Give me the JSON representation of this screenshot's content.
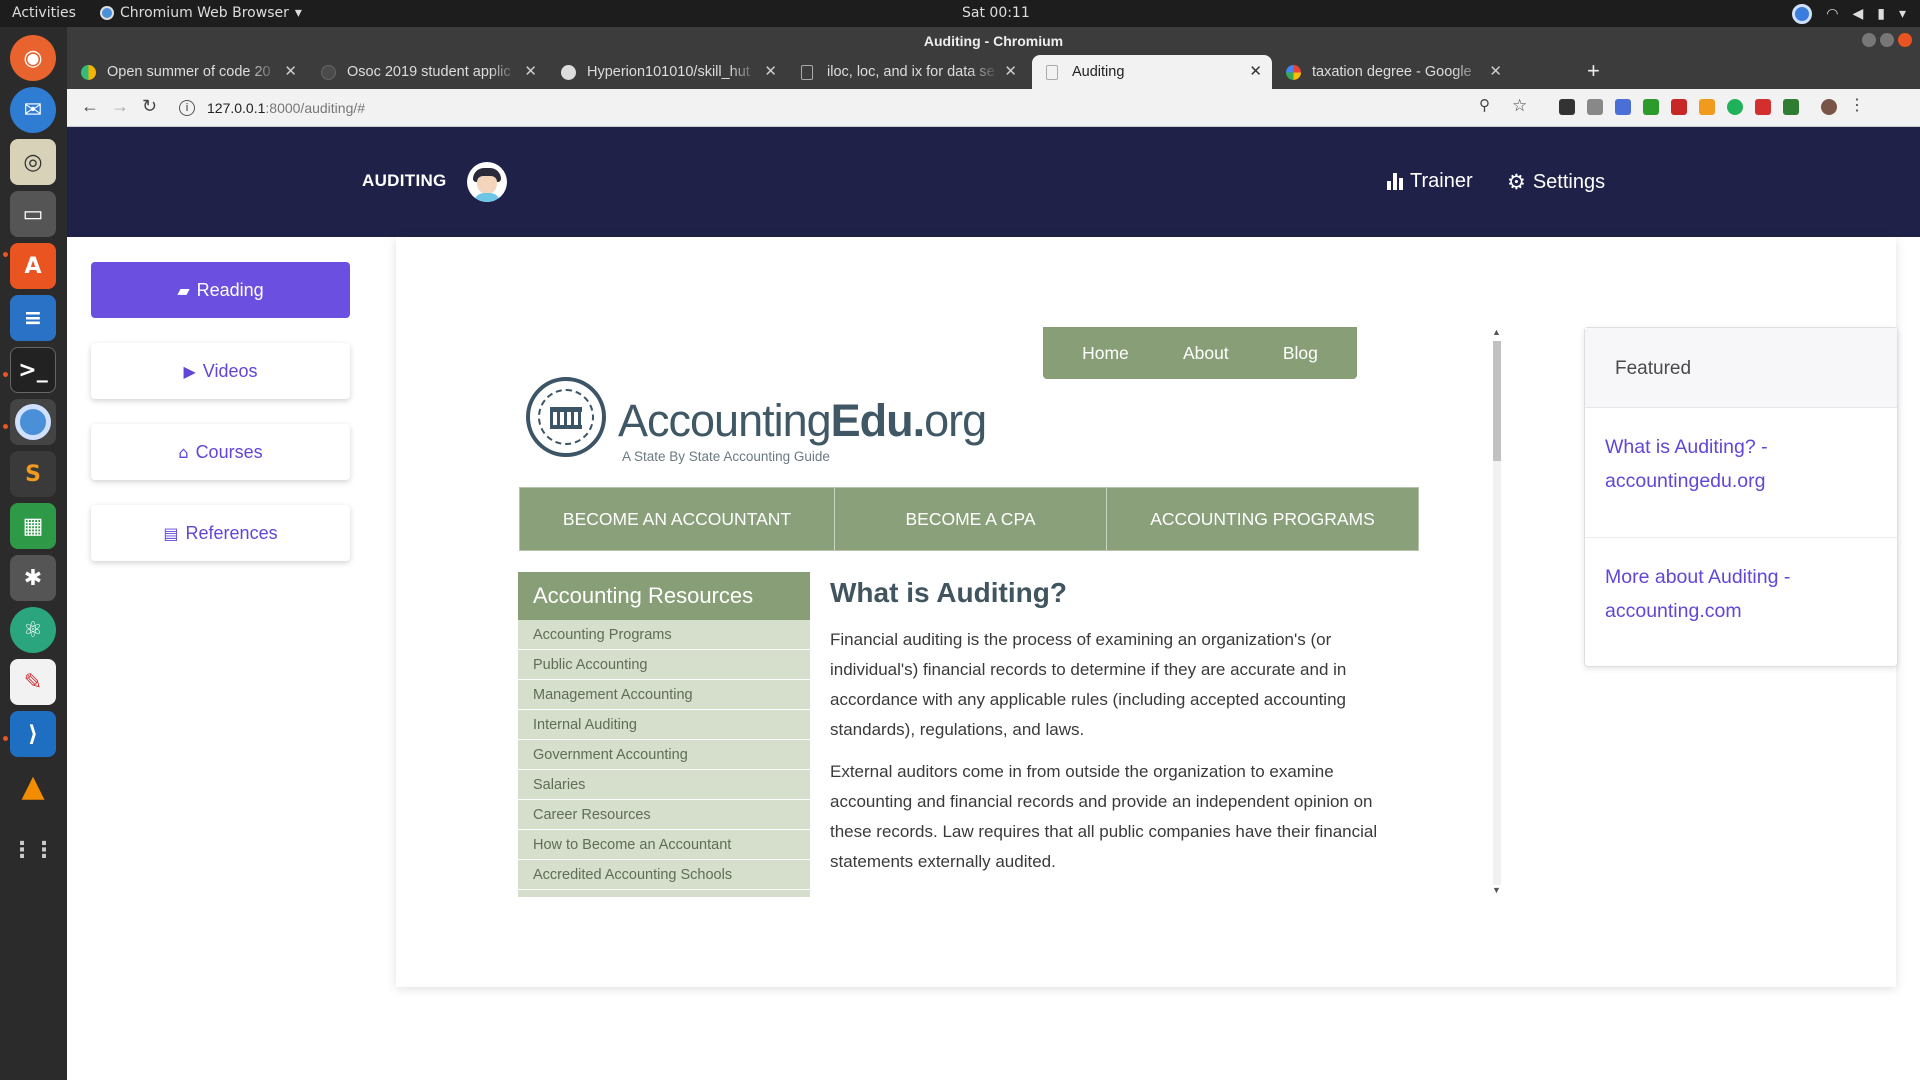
{
  "system": {
    "activities": "Activities",
    "app_menu": "Chromium Web Browser",
    "clock": "Sat 00:11"
  },
  "browser": {
    "window_title": "Auditing - Chromium",
    "tabs": [
      {
        "title": "Open summer of code 20"
      },
      {
        "title": "Osoc 2019 student applic"
      },
      {
        "title": "Hyperion101010/skill_hut"
      },
      {
        "title": "iloc, loc, and ix for data se"
      },
      {
        "title": "Auditing"
      },
      {
        "title": "taxation degree - Google"
      }
    ],
    "url_host": "127.0.0.1",
    "url_path": ":8000/auditing/#"
  },
  "app": {
    "brand": "AUDITING",
    "nav": {
      "trainer": "Trainer",
      "settings": "Settings"
    },
    "sidebar": [
      {
        "label": "Reading",
        "icon": "book-icon"
      },
      {
        "label": "Videos",
        "icon": "play-icon"
      },
      {
        "label": "Courses",
        "icon": "institution-icon"
      },
      {
        "label": "References",
        "icon": "file-icon"
      }
    ],
    "accent": "#6a4fe0",
    "navbar_bg": "#1f2148"
  },
  "embed": {
    "site_nav": [
      "Home",
      "About",
      "Blog"
    ],
    "logo_light": "Accounting",
    "logo_bold": "Edu.",
    "logo_tail": "org",
    "tagline": "A State By State Accounting Guide",
    "categories": [
      "BECOME AN ACCOUNTANT",
      "BECOME A CPA",
      "ACCOUNTING PROGRAMS"
    ],
    "resources_title": "Accounting Resources",
    "resources": [
      "Accounting Programs",
      "Public Accounting",
      "Management Accounting",
      "Internal Auditing",
      "Government Accounting",
      "Salaries",
      "Career Resources",
      "How to Become an Accountant",
      "Accredited Accounting Schools"
    ],
    "article_title": "What is Auditing?",
    "article_p1": "Financial auditing is the process of examining an organization's (or individual's) financial records to determine if they are accurate and in accordance with any applicable rules (including accepted accounting standards), regulations, and laws.",
    "article_p2": "External auditors come in from outside the organization to examine accounting and financial records and provide an independent opinion on these records. Law requires that all public companies have their financial statements externally audited."
  },
  "featured": {
    "title": "Featured",
    "links": [
      "What is Auditing? - accountingedu.org",
      "More about Auditing - accounting.com"
    ]
  }
}
